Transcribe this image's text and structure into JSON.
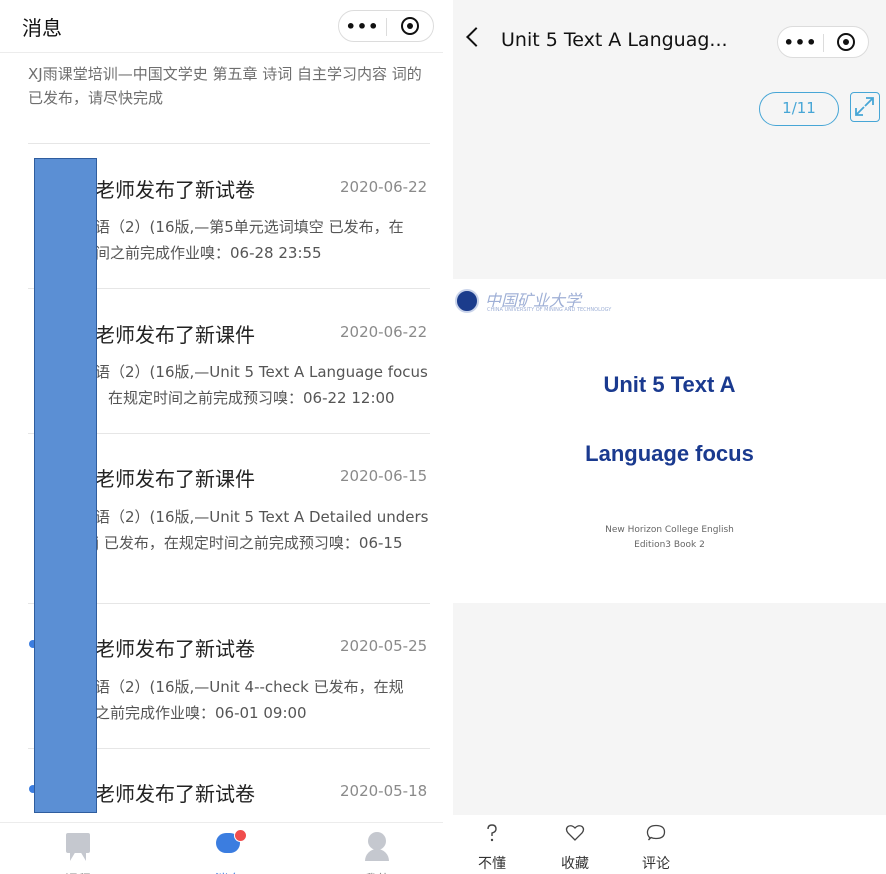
{
  "left": {
    "header": {
      "title": "消息",
      "menu_glyph": "•••"
    },
    "first_message": "XJ雨课堂培训—中国文学史 第五章 诗词 自主学习内容 词的 已发布，请尽快完成",
    "messages": [
      {
        "title": "老师发布了新试卷",
        "date": "2020-06-22",
        "line1": "语（2）(16版,—第5单元选词填空 已发布，在",
        "line2": "间之前完成作业嗅：06-28 23:55",
        "unread": false
      },
      {
        "title": "老师发布了新课件",
        "date": "2020-06-22",
        "line1": "语（2）(16版,—Unit 5 Text A Language focus",
        "line2": "在规定时间之前完成预习嗅：06-22 12:00",
        "unread": false
      },
      {
        "title": "老师发布了新课件",
        "date": "2020-06-15",
        "line1": "语（2）(16版,—Unit 5 Text A Detailed unders",
        "line2": "j 已发布，在规定时间之前完成预习嗅：06-15",
        "unread": false
      },
      {
        "title": "老师发布了新试卷",
        "date": "2020-05-25",
        "line1": "语（2）(16版,—Unit 4--check 已发布，在规",
        "line2": "之前完成作业嗅：06-01 09:00",
        "unread": true
      },
      {
        "title": "老师发布了新试卷",
        "date": "2020-05-18",
        "line1": "",
        "line2": "",
        "unread": true
      }
    ],
    "tabs": [
      {
        "label": "课程",
        "icon": "course-icon",
        "active": false
      },
      {
        "label": "消息",
        "icon": "message-icon",
        "active": true
      },
      {
        "label": "我的",
        "icon": "profile-icon",
        "active": false
      }
    ],
    "colors": {
      "accent": "#3b7de0",
      "badge": "#f04d4d",
      "redaction": "#5b8fd4"
    }
  },
  "right": {
    "header": {
      "title": "Unit 5 Text A Languag..."
    },
    "page_indicator": "1/11",
    "slide": {
      "logo_text": "中国矿业大学",
      "logo_sub": "CHINA UNIVERSITY OF MINING AND TECHNOLOGY",
      "title_line1": "Unit 5  Text A",
      "title_line2": "Language focus",
      "subtitle_line1": "New Horizon College English",
      "subtitle_line2": "Edition3 Book 2"
    },
    "bottom_actions": [
      {
        "label": "不懂",
        "icon": "question-icon"
      },
      {
        "label": "收藏",
        "icon": "heart-icon"
      },
      {
        "label": "评论",
        "icon": "comment-icon"
      }
    ],
    "colors": {
      "accent": "#47a6d6",
      "slide_title": "#1a3a8f"
    }
  }
}
